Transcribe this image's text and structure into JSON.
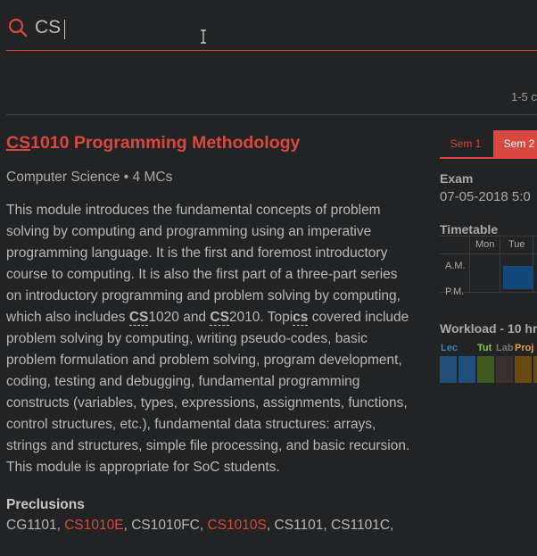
{
  "search": {
    "value": "CS"
  },
  "results": {
    "count_text": "1-5 c"
  },
  "module": {
    "title_highlight": "CS",
    "title_rest": "1010 Programming Methodology",
    "subtitle": "Computer Science • 4 MCs",
    "description": {
      "part1": "This module introduces the fundamental concepts of problem solving by computing and programming using an imperative programming language. It is the first and foremost introductory course to computing. It is also the first part of a three-part series on introductory programming and problem solving by computing, which also includes ",
      "hl1": "CS",
      "part2": "1020 and ",
      "hl2": "CS",
      "part3": "2010. Topi",
      "hl3": "cs",
      "part4": " covered include problem solving by computing, writing pseudo-codes, basic problem formulation and problem solving, program development, coding, testing and debugging, fundamental programming constructs (variables, types, expressions, assignments, functions, control structures, etc.), fundamental data structures: arrays, strings and structures, simple file processing, and basic recursion. This module is appropriate for SoC students."
    },
    "preclusions_heading": "Preclusions",
    "preclusions": [
      {
        "code": "CG1101",
        "link": false
      },
      {
        "code": "CS1010E",
        "link": true
      },
      {
        "code": "CS1010FC",
        "link": false
      },
      {
        "code": "CS1010S",
        "link": true
      },
      {
        "code": "CS1101",
        "link": false
      },
      {
        "code": "CS1101C,",
        "link": false
      }
    ]
  },
  "sidebar": {
    "sem_tabs": [
      {
        "label": "Sem 1",
        "active": false
      },
      {
        "label": "Sem 2",
        "active": true
      }
    ],
    "exam_label": "Exam",
    "exam_date": "07-05-2018 5:0",
    "timetable_label": "Timetable",
    "days": [
      "Mon",
      "Tue"
    ],
    "am_label": "A.M.",
    "pm_label": "P.M.",
    "workload_label": "Workload - 10 hr",
    "workload_tags": [
      {
        "label": "Lec",
        "color": "#2e86c9"
      },
      {
        "label": "Tut",
        "color": "#8bc34a"
      },
      {
        "label": "Lab",
        "color": "#777777"
      },
      {
        "label": "Proj",
        "color": "#e8a33a"
      }
    ],
    "colors": {
      "accent": "#d9483e",
      "lec": "#1f4e78",
      "tut": "#3f5a1f",
      "lab": "#3a3030",
      "proj": "#6b4a12"
    }
  }
}
